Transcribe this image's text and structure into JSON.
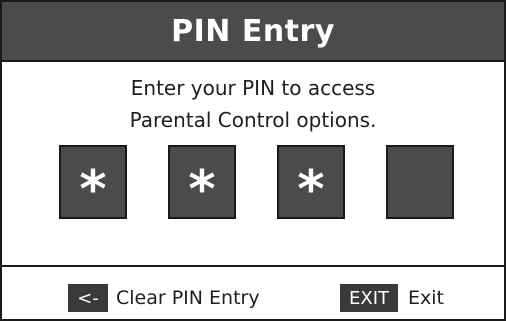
{
  "dialog": {
    "title": "PIN Entry",
    "instructions": {
      "line1": "Enter your PIN to access",
      "line2": "Parental Control options."
    },
    "pin_boxes": [
      {
        "value": "*"
      },
      {
        "value": "*"
      },
      {
        "value": "*"
      },
      {
        "value": ""
      }
    ]
  },
  "footer": {
    "clear": {
      "key": "<-",
      "label": "Clear PIN Entry"
    },
    "exit": {
      "key": "EXIT",
      "label": "Exit"
    }
  },
  "colors": {
    "title_bar": "#4b4b4b",
    "pin_box": "#4b4b4b",
    "key_badge": "#3a3a3a",
    "border": "#1a1a1a",
    "background": "#ffffff"
  }
}
